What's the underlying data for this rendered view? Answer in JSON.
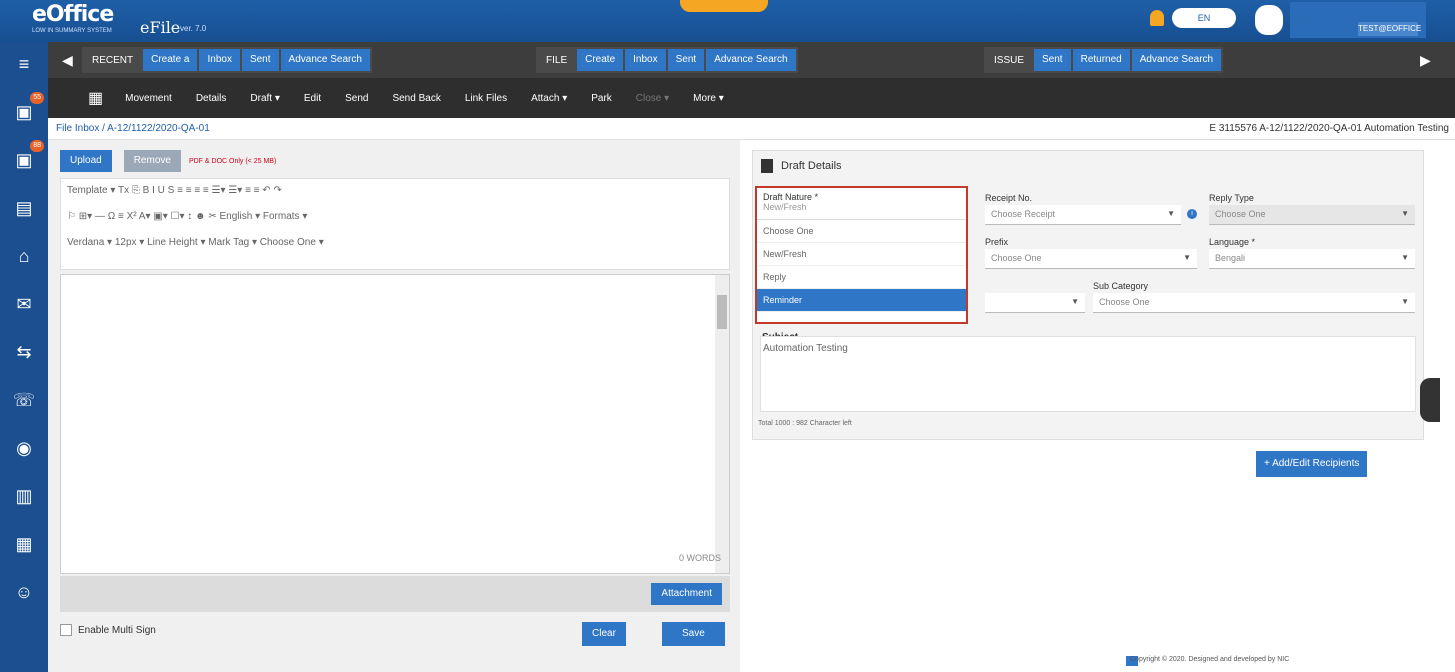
{
  "header": {
    "logo": "eOffice",
    "logo_sub": "LOW IN SUMMARY SYSTEM",
    "app_name": "eFile",
    "version": "ver. 7.0",
    "language": "EN",
    "user_line": "TEST@EOFFICE"
  },
  "leftbar": {
    "items": [
      {
        "name": "menu-icon",
        "glyph": "≡"
      },
      {
        "name": "efile-icon",
        "glyph": "▣",
        "badge": "55"
      },
      {
        "name": "efile-receipt-icon",
        "glyph": "▣",
        "badge": "88"
      },
      {
        "name": "tasks-icon",
        "glyph": "▤"
      },
      {
        "name": "home-icon",
        "glyph": "⌂"
      },
      {
        "name": "dak-icon",
        "glyph": "✉"
      },
      {
        "name": "transfer-icon",
        "glyph": "⇆"
      },
      {
        "name": "phone-icon",
        "glyph": "☏"
      },
      {
        "name": "globe-icon",
        "glyph": "◉"
      },
      {
        "name": "book-icon",
        "glyph": "▥"
      },
      {
        "name": "report-icon",
        "glyph": "▦"
      },
      {
        "name": "people-icon",
        "glyph": "☺"
      }
    ]
  },
  "nav": {
    "recent": {
      "label": "RECENT",
      "items": [
        "Create a",
        "Inbox",
        "Sent",
        "Advance Search"
      ]
    },
    "file": {
      "label": "FILE",
      "items": [
        "Create",
        "Inbox",
        "Sent",
        "Advance Search"
      ]
    },
    "issue": {
      "label": "ISSUE",
      "items": [
        "Sent",
        "Returned",
        "Advance Search"
      ]
    }
  },
  "toolbar": {
    "items": [
      "Movement",
      "Details",
      "Draft ▾",
      "Edit",
      "Send",
      "Send Back",
      "Link Files",
      "Attach ▾",
      "Park",
      "Close ▾",
      "More ▾"
    ],
    "disabled_index": 9
  },
  "breadcrumb": "File Inbox / A-12/1122/2020-QA-01",
  "file_info": "E 3115576 A-12/1122/2020-QA-01 Automation Testing",
  "editor": {
    "upload": "Upload",
    "remove": "Remove",
    "hint": "PDF & DOC Only (< 25 MB)",
    "tb1": "Template  ▾   Tx   ⎘    B   I   U   S   ≡   ≡   ≡   ≡   ☰▾  ☰▾  ≡  ≡   ↶  ↷",
    "tb2": "⚐  ⊞▾   —  Ω   ≡  X²  A▾  ▣▾  ☐▾  ↕  ☻  ✂  English ▾  Formats ▾",
    "tb3": "Verdana   ▾   12px   ▾   Line Height  ▾   Mark Tag   ▾   Choose One ▾",
    "words": "0 WORDS",
    "attachment": "Attachment",
    "multi_sign": "Enable Multi Sign",
    "clear": "Clear",
    "save": "Save"
  },
  "draft": {
    "title": "Draft Details",
    "draft_nature_label": "Draft Nature *",
    "draft_nature_value": "New/Fresh",
    "options": [
      "Choose One",
      "New/Fresh",
      "Reply",
      "Reminder"
    ],
    "selected_index": 3,
    "receipt_label": "Receipt No.",
    "receipt_value": "Choose Receipt",
    "reply_type_label": "Reply Type",
    "reply_type_value": "Choose One",
    "prefix_label": "Prefix",
    "prefix_value": "Choose One",
    "language_label": "Language *",
    "language_value": "Bengali",
    "subcat_label": "Sub Category",
    "subcat_value": "Choose One",
    "subject_label": "Subject",
    "subject_value": "Automation Testing",
    "char_info": "Total 1000 : 982 Character left",
    "add_recipients": "Add/Edit Recipients"
  },
  "footer": "Copyright © 2020. Designed and developed by NIC"
}
